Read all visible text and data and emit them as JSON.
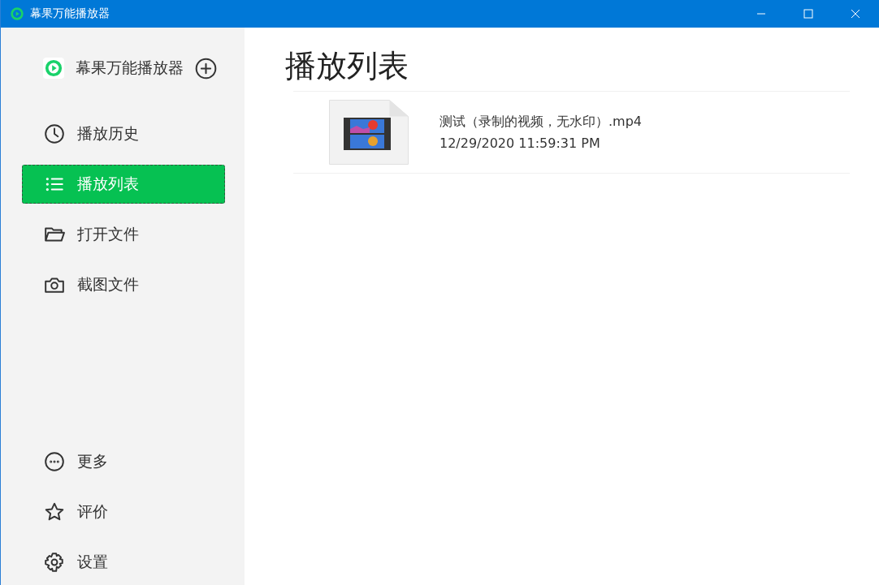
{
  "window": {
    "title": "幕果万能播放器"
  },
  "sidebar": {
    "app_name": "幕果万能播放器",
    "items": [
      {
        "label": "播放历史",
        "selected": false
      },
      {
        "label": "播放列表",
        "selected": true
      },
      {
        "label": "打开文件",
        "selected": false
      },
      {
        "label": "截图文件",
        "selected": false
      }
    ],
    "bottom_items": [
      {
        "label": "更多"
      },
      {
        "label": "评价"
      },
      {
        "label": "设置"
      }
    ]
  },
  "main": {
    "heading": "播放列表",
    "files": [
      {
        "name": "测试（录制的视频，无水印）.mp4",
        "date": "12/29/2020 11:59:31 PM"
      }
    ]
  }
}
